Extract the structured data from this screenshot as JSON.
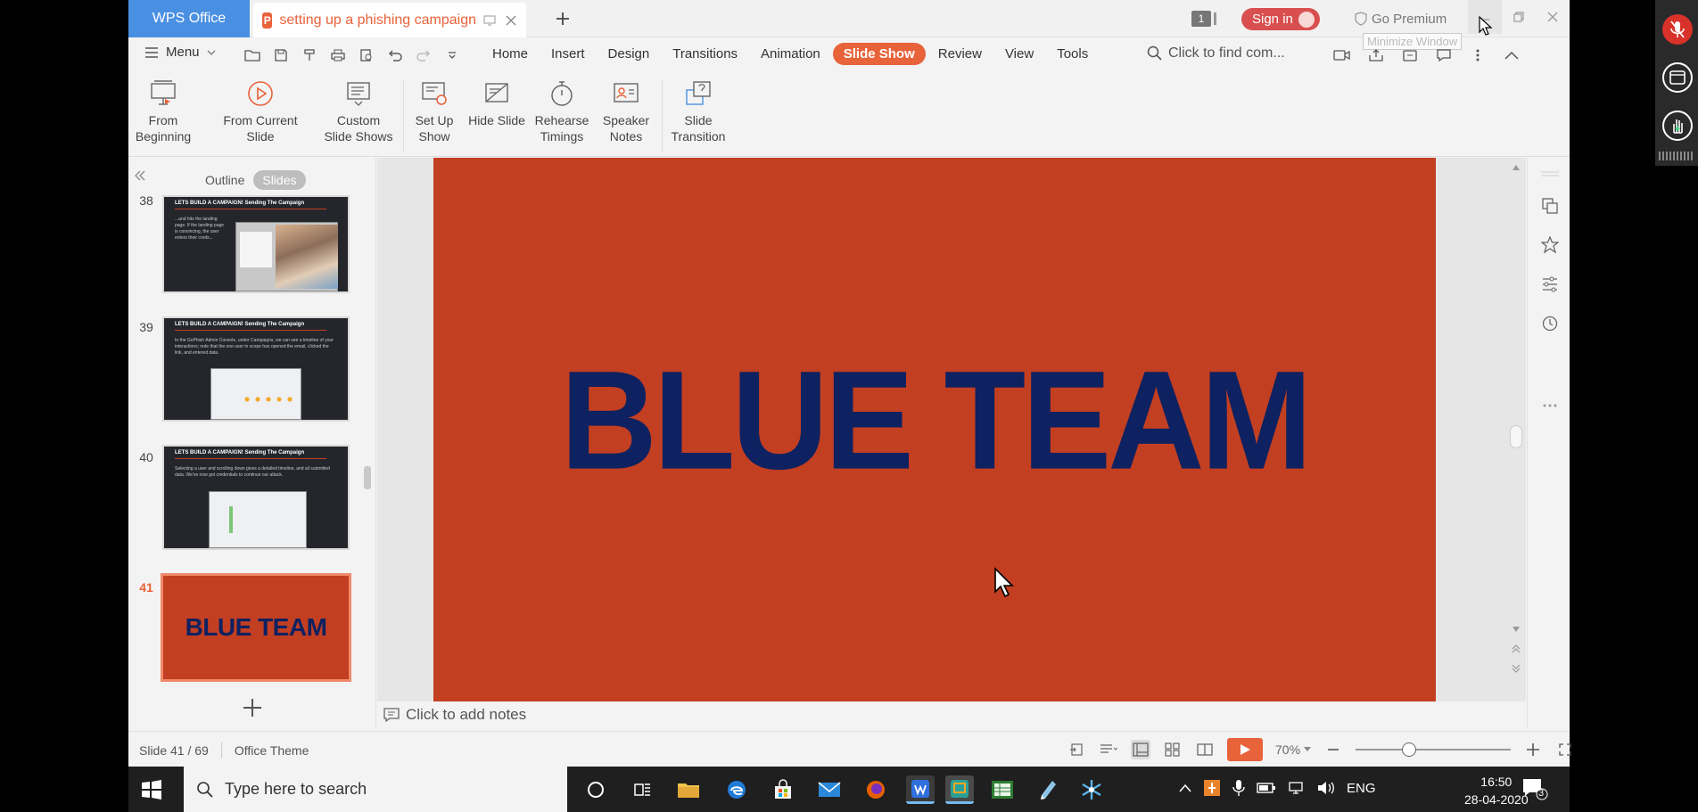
{
  "titlebar": {
    "app_tab": "WPS Office",
    "doc_tab": "setting up a phishing campaign",
    "badge_count": "1",
    "sign_in": "Sign in",
    "premium": "Go Premium",
    "tooltip": "Minimize Window"
  },
  "menubar": {
    "menu_label": "Menu",
    "tabs": [
      "Home",
      "Insert",
      "Design",
      "Transitions",
      "Animation",
      "Slide Show",
      "Review",
      "View",
      "Tools"
    ],
    "active_tab": "Slide Show",
    "find_placeholder": "Click to find com..."
  },
  "ribbon": {
    "from_beginning": [
      "From",
      "Beginning"
    ],
    "from_current": "From Current Slide",
    "custom_shows": [
      "Custom",
      "Slide Shows"
    ],
    "set_up_show": [
      "Set Up",
      "Show"
    ],
    "hide_slide": "Hide Slide",
    "rehearse": [
      "Rehearse",
      "Timings"
    ],
    "speaker_notes": [
      "Speaker",
      "Notes"
    ],
    "slide_transition": [
      "Slide",
      "Transition"
    ]
  },
  "leftpanel": {
    "outline_label": "Outline",
    "slides_label": "Slides",
    "thumbnails": [
      {
        "num": "38",
        "title": "LETS BUILD A CAMPAIGN! Sending The Campaign",
        "text": "...and hits the landing page. If the landing page is convincing, the user enters their creds..."
      },
      {
        "num": "39",
        "title": "LETS BUILD A CAMPAIGN! Sending The Campaign",
        "text": "In the GoPhish Admin Console, under Campaigns, we can see a timeline of your interactions; note that the one user in scope has opened the email, clicked the link, and entered data."
      },
      {
        "num": "40",
        "title": "LETS BUILD A CAMPAIGN! Sending The Campaign",
        "text": "Selecting a user and scrolling down gives a detailed timeline, and all submitted data. We've now got credentials to continue our attack."
      },
      {
        "num": "41",
        "title": "BLUE TEAM",
        "text": ""
      }
    ]
  },
  "slide": {
    "text": "BLUE TEAM"
  },
  "notes": {
    "placeholder": "Click to add notes"
  },
  "statusbar": {
    "slide_counter": "Slide 41 / 69",
    "theme": "Office Theme",
    "zoom": "70%"
  },
  "taskbar": {
    "search_placeholder": "Type here to search",
    "language": "ENG",
    "time": "16:50",
    "date": "28-04-2020",
    "notification_count": "3"
  },
  "colors": {
    "accent": "#e8623a",
    "slide_bg": "#c23f22",
    "slide_text": "#0e2160",
    "wps_blue": "#4a90e2"
  }
}
